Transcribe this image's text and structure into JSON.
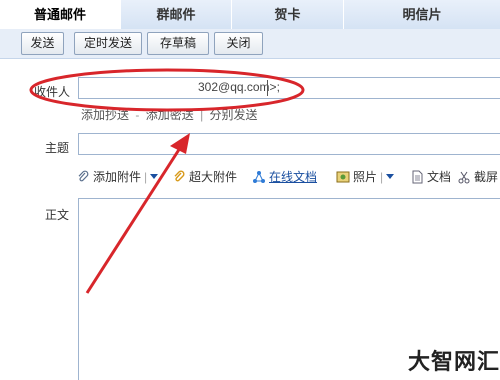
{
  "tabs": [
    {
      "label": "普通邮件",
      "active": true
    },
    {
      "label": "群邮件",
      "active": false
    },
    {
      "label": "贺卡",
      "active": false
    },
    {
      "label": "明信片",
      "active": false
    }
  ],
  "toolbar": {
    "send": "发送",
    "schedule_send": "定时发送",
    "save_draft": "存草稿",
    "close": "关闭"
  },
  "form": {
    "recipient_label": "收件人",
    "recipient_value": "302@qq.com>;",
    "add_cc": "添加抄送",
    "dash": "-",
    "add_bcc": "添加密送",
    "pipe": "|",
    "separate_send": "分别发送",
    "subject_label": "主题",
    "body_label": "正文"
  },
  "attach_bar": {
    "add_attachment": "添加附件",
    "large_attachment": "超大附件",
    "online_doc": "在线文档",
    "photo": "照片",
    "document": "文档",
    "screenshot": "截屏"
  },
  "colors": {
    "annotation_red": "#d8262b",
    "tab_active": "#ffffff",
    "toolbar_bg": "#e7eef8",
    "link_blue": "#1a4fa0"
  },
  "watermark": "大智网汇"
}
